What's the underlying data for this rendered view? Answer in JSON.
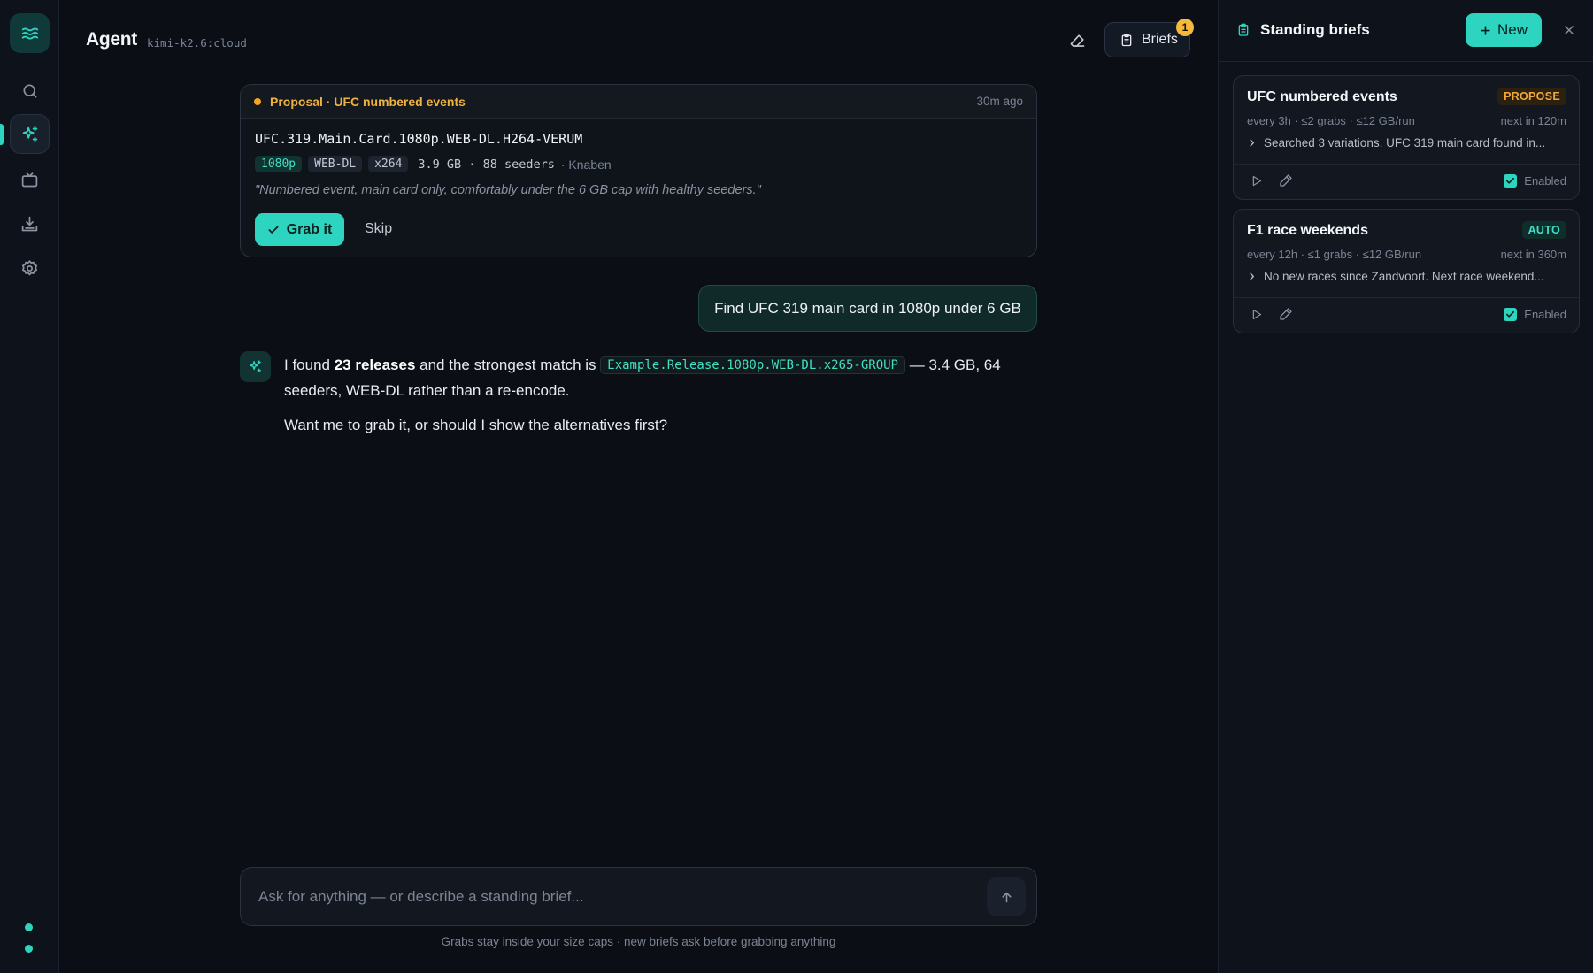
{
  "rail": {
    "items": [
      "search",
      "agent",
      "tv",
      "downloads",
      "settings"
    ]
  },
  "header": {
    "title": "Agent",
    "model": "kimi-k2.6:cloud",
    "briefs_label": "Briefs",
    "briefs_badge": "1"
  },
  "proposal": {
    "label": "Proposal · UFC numbered events",
    "time": "30m ago",
    "release": "UFC.319.Main.Card.1080p.WEB-DL.H264-VERUM",
    "tags": [
      "1080p",
      "WEB-DL",
      "x264"
    ],
    "size_seeders": "3.9 GB · 88 seeders",
    "source": "· Knaben",
    "quote": "\"Numbered event, main card only, comfortably under the 6 GB cap with healthy seeders.\"",
    "grab_label": "Grab it",
    "skip_label": "Skip"
  },
  "user_message": "Find UFC 319 main card in 1080p under 6 GB",
  "agent_reply": {
    "p1_a": "I found ",
    "p1_bold": "23 releases",
    "p1_b": " and the strongest match is ",
    "p1_code": "Example.Release.1080p.WEB-DL.x265-GROUP",
    "p1_c": " — 3.4 GB, 64 seeders, WEB-DL rather than a re-encode.",
    "p2": "Want me to grab it, or should I show the alternatives first?"
  },
  "composer": {
    "placeholder": "Ask for anything — or describe a standing brief...",
    "footnote": "Grabs stay inside your size caps · new briefs ask before grabbing anything"
  },
  "panel": {
    "title": "Standing briefs",
    "new_label": "New",
    "briefs": [
      {
        "title": "UFC numbered events",
        "mode": "PROPOSE",
        "meta": "every 3h · ≤2 grabs · ≤12 GB/run",
        "next": "next in 120m",
        "summary": "Searched 3 variations. UFC 319 main card found in...",
        "enabled_label": "Enabled"
      },
      {
        "title": "F1 race weekends",
        "mode": "AUTO",
        "meta": "every 12h · ≤1 grabs · ≤12 GB/run",
        "next": "next in 360m",
        "summary": "No new races since Zandvoort. Next race weekend...",
        "enabled_label": "Enabled"
      }
    ]
  },
  "colors": {
    "accent": "#2dd4bf",
    "warning": "#f5a524",
    "background": "#0b0e14"
  }
}
